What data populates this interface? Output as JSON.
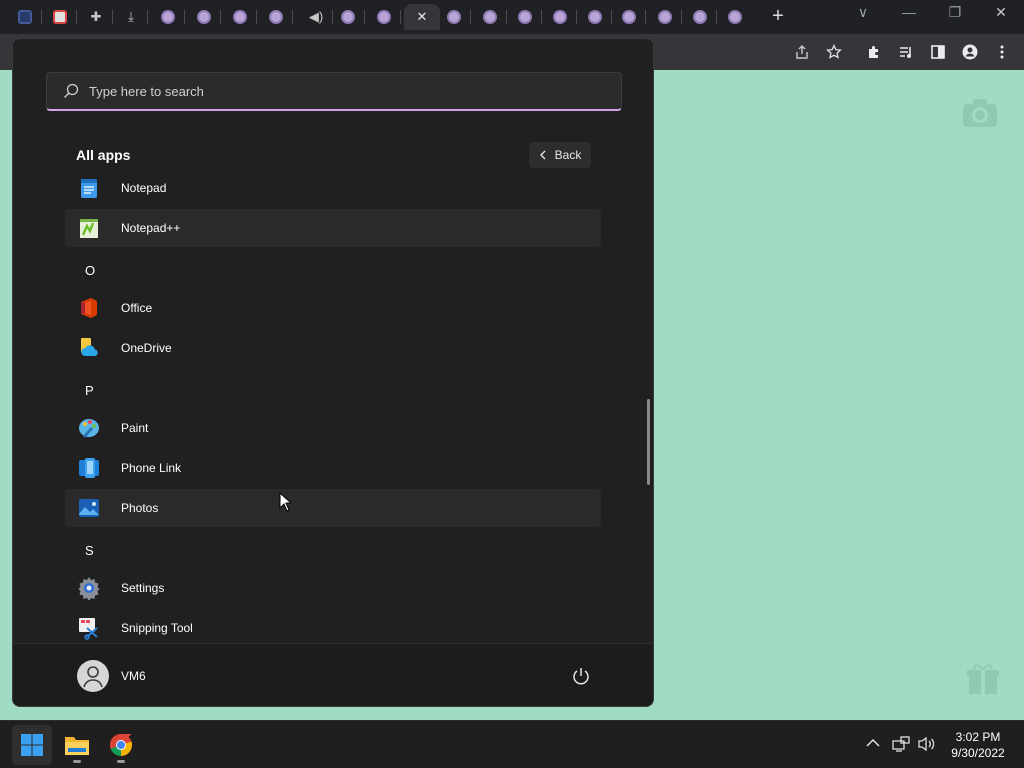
{
  "browser": {
    "tab_count_glyphs": [
      "mute-glyph",
      "close-glyph"
    ],
    "new_tab_label": "+",
    "window_controls": [
      "∨",
      "—",
      "❐",
      "✕"
    ]
  },
  "start_menu": {
    "search": {
      "placeholder": "Type here to search"
    },
    "section_title": "All apps",
    "back_label": "Back",
    "items": [
      {
        "type": "app",
        "label": "Notepad",
        "icon": "notepad-icon"
      },
      {
        "type": "app",
        "label": "Notepad++",
        "icon": "notepadpp-icon",
        "highlighted": true
      },
      {
        "type": "letter",
        "label": "O"
      },
      {
        "type": "app",
        "label": "Office",
        "icon": "office-icon"
      },
      {
        "type": "app",
        "label": "OneDrive",
        "icon": "onedrive-icon"
      },
      {
        "type": "letter",
        "label": "P"
      },
      {
        "type": "app",
        "label": "Paint",
        "icon": "paint-icon"
      },
      {
        "type": "app",
        "label": "Phone Link",
        "icon": "phone-link-icon"
      },
      {
        "type": "app",
        "label": "Photos",
        "icon": "photos-icon",
        "highlighted": true
      },
      {
        "type": "letter",
        "label": "S"
      },
      {
        "type": "app",
        "label": "Settings",
        "icon": "settings-icon"
      },
      {
        "type": "app",
        "label": "Snipping Tool",
        "icon": "snipping-tool-icon"
      }
    ],
    "user_name": "VM6"
  },
  "taskbar": {
    "apps": [
      "windows-start-icon",
      "file-explorer-icon",
      "chrome-icon"
    ],
    "time": "3:02 PM",
    "date": "9/30/2022"
  },
  "colors": {
    "page_background": "#a2dbc4",
    "accent_underline": "#d0a4e4"
  }
}
